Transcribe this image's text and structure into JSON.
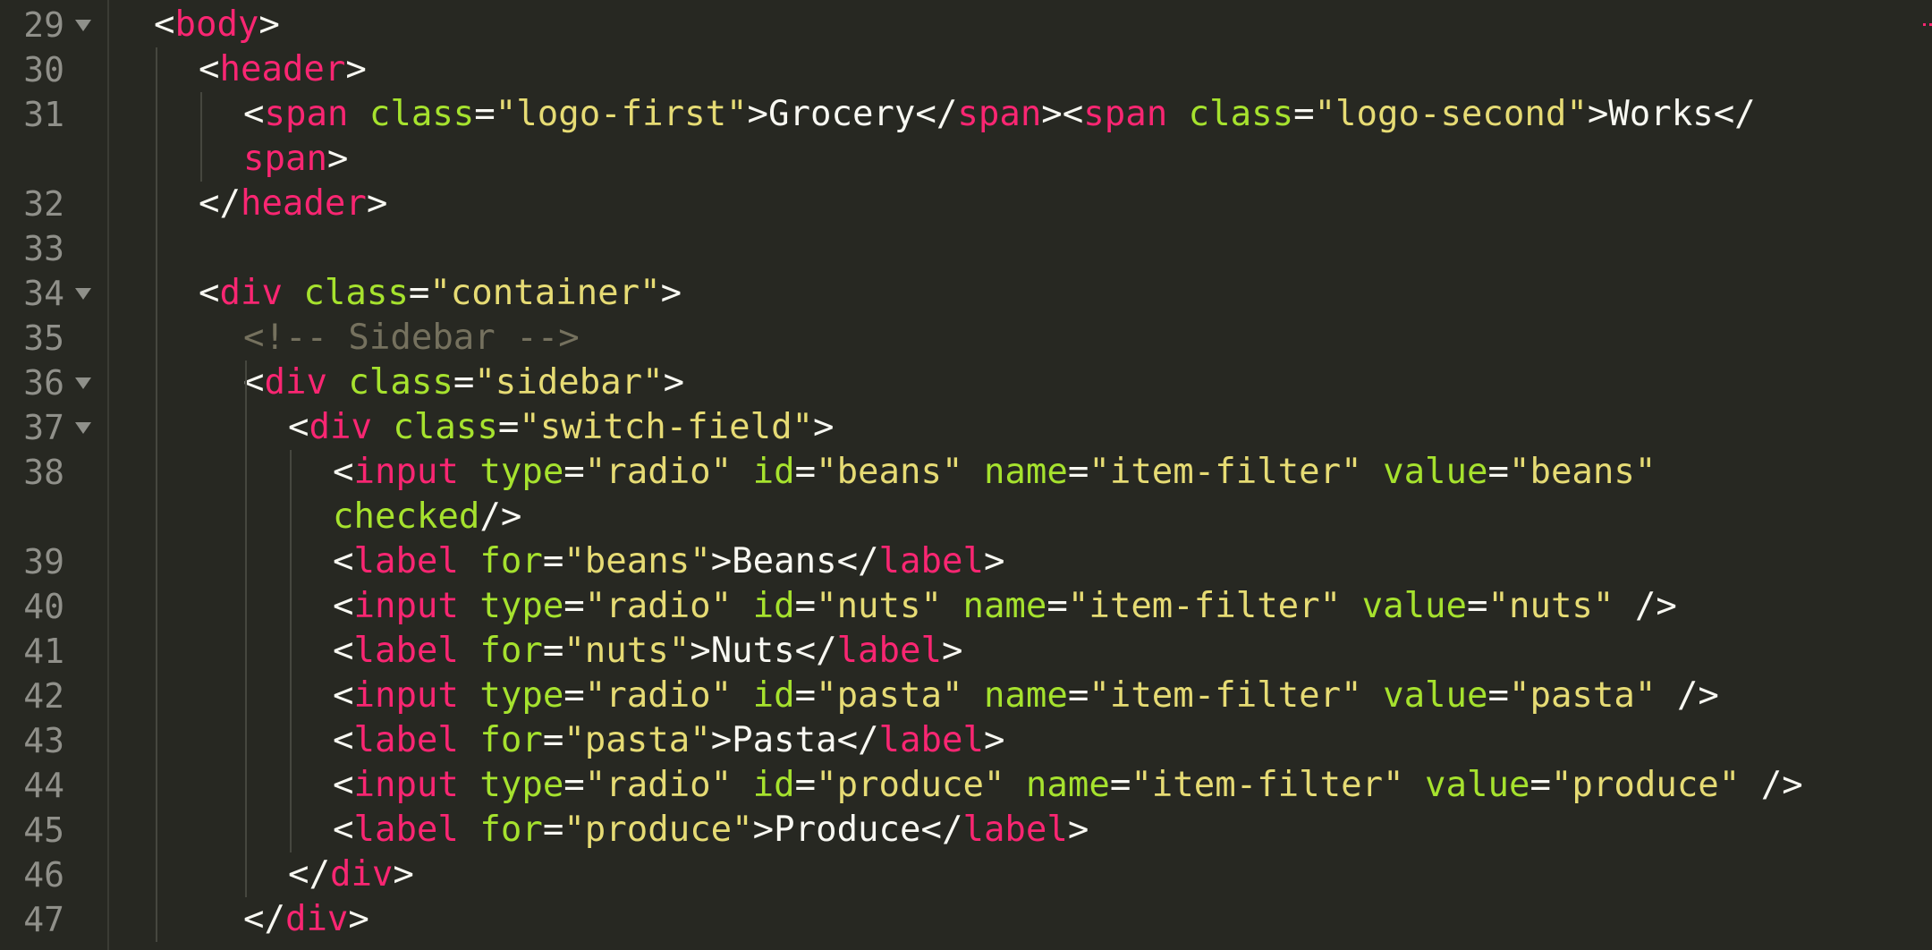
{
  "editor": {
    "theme_colors": {
      "background": "#272822",
      "tag": "#f92672",
      "attribute": "#a6e22e",
      "string": "#e6db74",
      "punctuation": "#f8f8f2",
      "comment": "#75715e",
      "line_number": "#90908a"
    },
    "lines": [
      {
        "no": "29",
        "fold": true,
        "cont": false,
        "tokens": [
          {
            "c": "p",
            "t": "<"
          },
          {
            "c": "t",
            "t": "body"
          },
          {
            "c": "p",
            "t": ">"
          }
        ]
      },
      {
        "no": "30",
        "fold": false,
        "cont": false,
        "tokens": [
          {
            "c": "p",
            "t": "<"
          },
          {
            "c": "t",
            "t": "header"
          },
          {
            "c": "p",
            "t": ">"
          }
        ]
      },
      {
        "no": "31",
        "fold": false,
        "cont": false,
        "tokens": [
          {
            "c": "p",
            "t": "<"
          },
          {
            "c": "t",
            "t": "span"
          },
          {
            "c": "p",
            "t": " "
          },
          {
            "c": "a",
            "t": "class"
          },
          {
            "c": "p",
            "t": "="
          },
          {
            "c": "s",
            "t": "\"logo-first\""
          },
          {
            "c": "p",
            "t": ">"
          },
          {
            "c": "txt",
            "t": "Grocery"
          },
          {
            "c": "p",
            "t": "</"
          },
          {
            "c": "t",
            "t": "span"
          },
          {
            "c": "p",
            "t": "><"
          },
          {
            "c": "t",
            "t": "span"
          },
          {
            "c": "p",
            "t": " "
          },
          {
            "c": "a",
            "t": "class"
          },
          {
            "c": "p",
            "t": "="
          },
          {
            "c": "s",
            "t": "\"logo-second\""
          },
          {
            "c": "p",
            "t": ">"
          },
          {
            "c": "txt",
            "t": "Works"
          },
          {
            "c": "p",
            "t": "</"
          }
        ]
      },
      {
        "no": "",
        "fold": false,
        "cont": true,
        "tokens": [
          {
            "c": "t",
            "t": "span"
          },
          {
            "c": "p",
            "t": ">"
          }
        ]
      },
      {
        "no": "32",
        "fold": false,
        "cont": false,
        "tokens": [
          {
            "c": "p",
            "t": "</"
          },
          {
            "c": "t",
            "t": "header"
          },
          {
            "c": "p",
            "t": ">"
          }
        ]
      },
      {
        "no": "33",
        "fold": false,
        "cont": false,
        "tokens": []
      },
      {
        "no": "34",
        "fold": true,
        "cont": false,
        "tokens": [
          {
            "c": "p",
            "t": "<"
          },
          {
            "c": "t",
            "t": "div"
          },
          {
            "c": "p",
            "t": " "
          },
          {
            "c": "a",
            "t": "class"
          },
          {
            "c": "p",
            "t": "="
          },
          {
            "c": "s",
            "t": "\"container\""
          },
          {
            "c": "p",
            "t": ">"
          }
        ]
      },
      {
        "no": "35",
        "fold": false,
        "cont": false,
        "tokens": [
          {
            "c": "c",
            "t": "<!-- Sidebar -->"
          }
        ]
      },
      {
        "no": "36",
        "fold": true,
        "cont": false,
        "tokens": [
          {
            "c": "p",
            "t": "<"
          },
          {
            "c": "t",
            "t": "div"
          },
          {
            "c": "p",
            "t": " "
          },
          {
            "c": "a",
            "t": "class"
          },
          {
            "c": "p",
            "t": "="
          },
          {
            "c": "s",
            "t": "\"sidebar\""
          },
          {
            "c": "p",
            "t": ">"
          }
        ]
      },
      {
        "no": "37",
        "fold": true,
        "cont": false,
        "tokens": [
          {
            "c": "p",
            "t": "<"
          },
          {
            "c": "t",
            "t": "div"
          },
          {
            "c": "p",
            "t": " "
          },
          {
            "c": "a",
            "t": "class"
          },
          {
            "c": "p",
            "t": "="
          },
          {
            "c": "s",
            "t": "\"switch-field\""
          },
          {
            "c": "p",
            "t": ">"
          }
        ]
      },
      {
        "no": "38",
        "fold": false,
        "cont": false,
        "tokens": [
          {
            "c": "p",
            "t": "<"
          },
          {
            "c": "t",
            "t": "input"
          },
          {
            "c": "p",
            "t": " "
          },
          {
            "c": "a",
            "t": "type"
          },
          {
            "c": "p",
            "t": "="
          },
          {
            "c": "s",
            "t": "\"radio\""
          },
          {
            "c": "p",
            "t": " "
          },
          {
            "c": "a",
            "t": "id"
          },
          {
            "c": "p",
            "t": "="
          },
          {
            "c": "s",
            "t": "\"beans\""
          },
          {
            "c": "p",
            "t": " "
          },
          {
            "c": "a",
            "t": "name"
          },
          {
            "c": "p",
            "t": "="
          },
          {
            "c": "s",
            "t": "\"item-filter\""
          },
          {
            "c": "p",
            "t": " "
          },
          {
            "c": "a",
            "t": "value"
          },
          {
            "c": "p",
            "t": "="
          },
          {
            "c": "s",
            "t": "\"beans\""
          }
        ]
      },
      {
        "no": "",
        "fold": false,
        "cont": true,
        "tokens": [
          {
            "c": "a",
            "t": "checked"
          },
          {
            "c": "p",
            "t": "/>"
          }
        ]
      },
      {
        "no": "39",
        "fold": false,
        "cont": false,
        "tokens": [
          {
            "c": "p",
            "t": "<"
          },
          {
            "c": "t",
            "t": "label"
          },
          {
            "c": "p",
            "t": " "
          },
          {
            "c": "a",
            "t": "for"
          },
          {
            "c": "p",
            "t": "="
          },
          {
            "c": "s",
            "t": "\"beans\""
          },
          {
            "c": "p",
            "t": ">"
          },
          {
            "c": "txt",
            "t": "Beans"
          },
          {
            "c": "p",
            "t": "</"
          },
          {
            "c": "t",
            "t": "label"
          },
          {
            "c": "p",
            "t": ">"
          }
        ]
      },
      {
        "no": "40",
        "fold": false,
        "cont": false,
        "tokens": [
          {
            "c": "p",
            "t": "<"
          },
          {
            "c": "t",
            "t": "input"
          },
          {
            "c": "p",
            "t": " "
          },
          {
            "c": "a",
            "t": "type"
          },
          {
            "c": "p",
            "t": "="
          },
          {
            "c": "s",
            "t": "\"radio\""
          },
          {
            "c": "p",
            "t": " "
          },
          {
            "c": "a",
            "t": "id"
          },
          {
            "c": "p",
            "t": "="
          },
          {
            "c": "s",
            "t": "\"nuts\""
          },
          {
            "c": "p",
            "t": " "
          },
          {
            "c": "a",
            "t": "name"
          },
          {
            "c": "p",
            "t": "="
          },
          {
            "c": "s",
            "t": "\"item-filter\""
          },
          {
            "c": "p",
            "t": " "
          },
          {
            "c": "a",
            "t": "value"
          },
          {
            "c": "p",
            "t": "="
          },
          {
            "c": "s",
            "t": "\"nuts\""
          },
          {
            "c": "p",
            "t": " />"
          }
        ]
      },
      {
        "no": "41",
        "fold": false,
        "cont": false,
        "tokens": [
          {
            "c": "p",
            "t": "<"
          },
          {
            "c": "t",
            "t": "label"
          },
          {
            "c": "p",
            "t": " "
          },
          {
            "c": "a",
            "t": "for"
          },
          {
            "c": "p",
            "t": "="
          },
          {
            "c": "s",
            "t": "\"nuts\""
          },
          {
            "c": "p",
            "t": ">"
          },
          {
            "c": "txt",
            "t": "Nuts"
          },
          {
            "c": "p",
            "t": "</"
          },
          {
            "c": "t",
            "t": "label"
          },
          {
            "c": "p",
            "t": ">"
          }
        ]
      },
      {
        "no": "42",
        "fold": false,
        "cont": false,
        "tokens": [
          {
            "c": "p",
            "t": "<"
          },
          {
            "c": "t",
            "t": "input"
          },
          {
            "c": "p",
            "t": " "
          },
          {
            "c": "a",
            "t": "type"
          },
          {
            "c": "p",
            "t": "="
          },
          {
            "c": "s",
            "t": "\"radio\""
          },
          {
            "c": "p",
            "t": " "
          },
          {
            "c": "a",
            "t": "id"
          },
          {
            "c": "p",
            "t": "="
          },
          {
            "c": "s",
            "t": "\"pasta\""
          },
          {
            "c": "p",
            "t": " "
          },
          {
            "c": "a",
            "t": "name"
          },
          {
            "c": "p",
            "t": "="
          },
          {
            "c": "s",
            "t": "\"item-filter\""
          },
          {
            "c": "p",
            "t": " "
          },
          {
            "c": "a",
            "t": "value"
          },
          {
            "c": "p",
            "t": "="
          },
          {
            "c": "s",
            "t": "\"pasta\""
          },
          {
            "c": "p",
            "t": " />"
          }
        ]
      },
      {
        "no": "43",
        "fold": false,
        "cont": false,
        "tokens": [
          {
            "c": "p",
            "t": "<"
          },
          {
            "c": "t",
            "t": "label"
          },
          {
            "c": "p",
            "t": " "
          },
          {
            "c": "a",
            "t": "for"
          },
          {
            "c": "p",
            "t": "="
          },
          {
            "c": "s",
            "t": "\"pasta\""
          },
          {
            "c": "p",
            "t": ">"
          },
          {
            "c": "txt",
            "t": "Pasta"
          },
          {
            "c": "p",
            "t": "</"
          },
          {
            "c": "t",
            "t": "label"
          },
          {
            "c": "p",
            "t": ">"
          }
        ]
      },
      {
        "no": "44",
        "fold": false,
        "cont": false,
        "tokens": [
          {
            "c": "p",
            "t": "<"
          },
          {
            "c": "t",
            "t": "input"
          },
          {
            "c": "p",
            "t": " "
          },
          {
            "c": "a",
            "t": "type"
          },
          {
            "c": "p",
            "t": "="
          },
          {
            "c": "s",
            "t": "\"radio\""
          },
          {
            "c": "p",
            "t": " "
          },
          {
            "c": "a",
            "t": "id"
          },
          {
            "c": "p",
            "t": "="
          },
          {
            "c": "s",
            "t": "\"produce\""
          },
          {
            "c": "p",
            "t": " "
          },
          {
            "c": "a",
            "t": "name"
          },
          {
            "c": "p",
            "t": "="
          },
          {
            "c": "s",
            "t": "\"item-filter\""
          },
          {
            "c": "p",
            "t": " "
          },
          {
            "c": "a",
            "t": "value"
          },
          {
            "c": "p",
            "t": "="
          },
          {
            "c": "s",
            "t": "\"produce\""
          },
          {
            "c": "p",
            "t": " />"
          }
        ]
      },
      {
        "no": "45",
        "fold": false,
        "cont": false,
        "tokens": [
          {
            "c": "p",
            "t": "<"
          },
          {
            "c": "t",
            "t": "label"
          },
          {
            "c": "p",
            "t": " "
          },
          {
            "c": "a",
            "t": "for"
          },
          {
            "c": "p",
            "t": "="
          },
          {
            "c": "s",
            "t": "\"produce\""
          },
          {
            "c": "p",
            "t": ">"
          },
          {
            "c": "txt",
            "t": "Produce"
          },
          {
            "c": "p",
            "t": "</"
          },
          {
            "c": "t",
            "t": "label"
          },
          {
            "c": "p",
            "t": ">"
          }
        ]
      },
      {
        "no": "46",
        "fold": false,
        "cont": false,
        "tokens": [
          {
            "c": "p",
            "t": "</"
          },
          {
            "c": "t",
            "t": "div"
          },
          {
            "c": "p",
            "t": ">"
          }
        ]
      },
      {
        "no": "47",
        "fold": false,
        "cont": false,
        "tokens": [
          {
            "c": "p",
            "t": "</"
          },
          {
            "c": "t",
            "t": "div"
          },
          {
            "c": "p",
            "t": ">"
          }
        ]
      }
    ]
  }
}
